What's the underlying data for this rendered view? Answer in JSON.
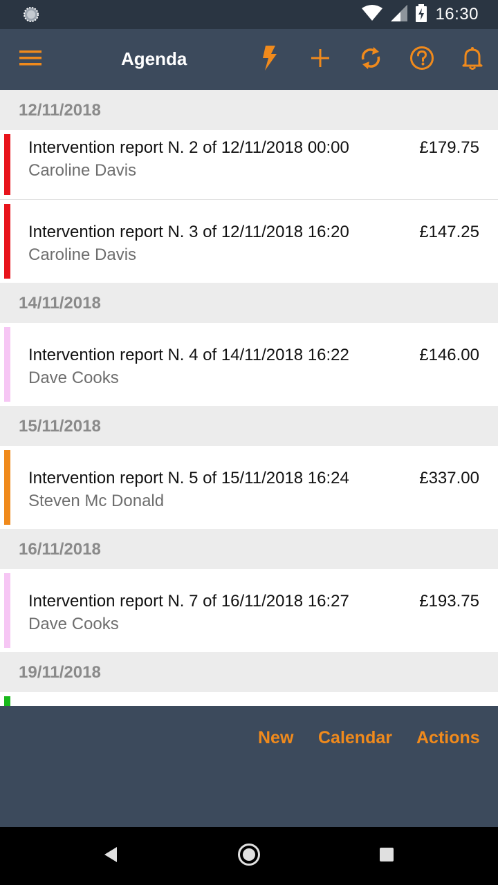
{
  "status_bar": {
    "time": "16:30",
    "icons": [
      "settings-dial-icon",
      "wifi-icon",
      "cell-signal-icon",
      "battery-charging-icon"
    ]
  },
  "toolbar": {
    "title": "Agenda",
    "icons": [
      "menu-icon",
      "flash-icon",
      "add-icon",
      "sync-icon",
      "help-icon",
      "bell-icon"
    ],
    "accent": "#f08a1c"
  },
  "agenda": [
    {
      "date": "12/11/2018",
      "items": [
        {
          "title": "Intervention report N. 2 of 12/11/2018 00:00",
          "client": "Caroline Davis",
          "amount": "£179.75",
          "color": "#e8141c"
        },
        {
          "title": "Intervention report N. 3 of 12/11/2018 16:20",
          "client": "Caroline Davis",
          "amount": "£147.25",
          "color": "#e8141c"
        }
      ]
    },
    {
      "date": "14/11/2018",
      "items": [
        {
          "title": "Intervention report N. 4 of 14/11/2018 16:22",
          "client": "Dave Cooks",
          "amount": "£146.00",
          "color": "#f6c6f4"
        }
      ]
    },
    {
      "date": "15/11/2018",
      "items": [
        {
          "title": "Intervention report N. 5 of 15/11/2018 16:24",
          "client": "Steven Mc Donald",
          "amount": "£337.00",
          "color": "#f08a1c"
        }
      ]
    },
    {
      "date": "16/11/2018",
      "items": [
        {
          "title": "Intervention report N. 7 of 16/11/2018 16:27",
          "client": "Dave Cooks",
          "amount": "£193.75",
          "color": "#f6c6f4"
        }
      ]
    },
    {
      "date": "19/11/2018",
      "items": [
        {
          "title": "",
          "client": "",
          "amount": "",
          "color": "#19b81c"
        }
      ]
    }
  ],
  "bottom_actions": {
    "new": "New",
    "calendar": "Calendar",
    "actions": "Actions"
  },
  "nav_bar": {
    "icons": [
      "back-icon",
      "home-icon",
      "recents-icon"
    ]
  }
}
